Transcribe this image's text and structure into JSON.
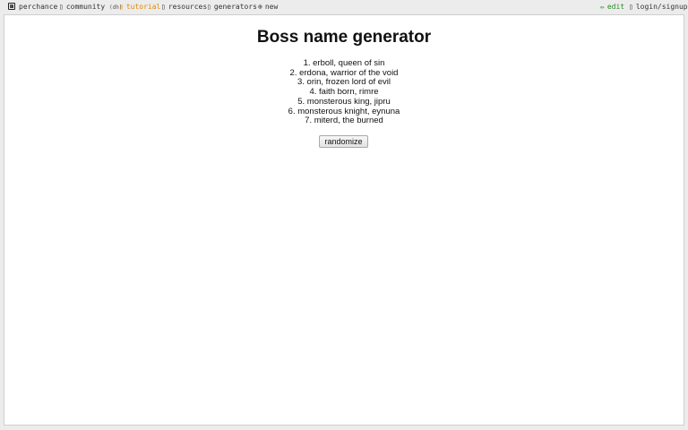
{
  "nav": {
    "site": "perchance",
    "community": "community",
    "community_sub": "(dh)",
    "tutorial": "tutorial",
    "resources": "resources",
    "generators": "generators",
    "new": "new",
    "edit": "edit",
    "login": "login/signup"
  },
  "page": {
    "title": "Boss name generator",
    "names": [
      "1. erboll, queen of sin",
      "2. erdona, warrior of the void",
      "3. orin, frozen lord of evil",
      "4. faith born, rimre",
      "5. monsterous king, jipru",
      "6. monsterous knight, eynuna",
      "7. miterd, the burned"
    ],
    "button_label": "randomize"
  },
  "colors": {
    "tutorial": "#e08a00",
    "edit": "#2a8a2a"
  }
}
